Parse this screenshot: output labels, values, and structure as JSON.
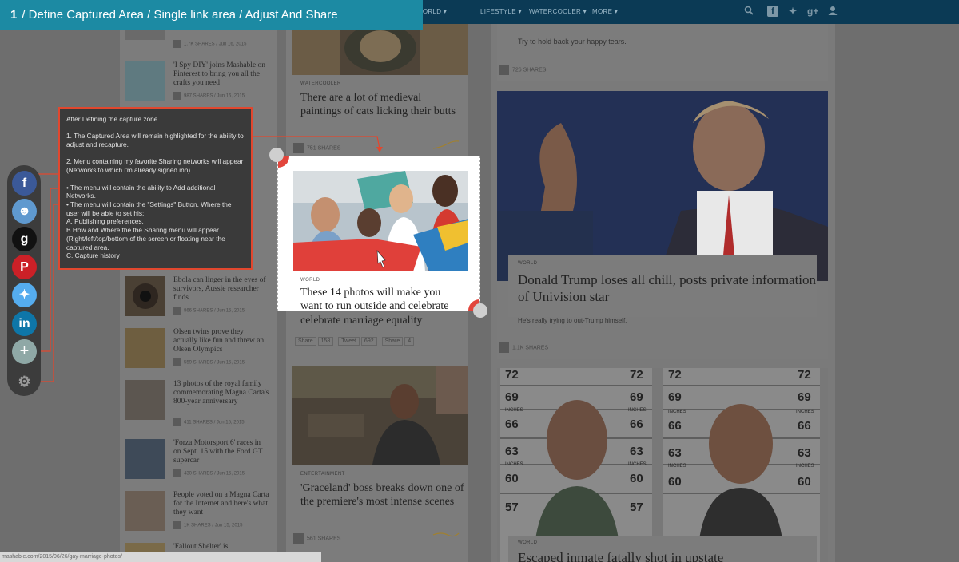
{
  "banner": {
    "step": "1",
    "path": "/ Define Captured Area / Single link area / Adjust And Share"
  },
  "nav": {
    "items": [
      "WORLD",
      "LIFESTYLE",
      "WATERCOOLER",
      "MORE"
    ],
    "icons": [
      "search-icon",
      "facebook-icon",
      "twitter-icon",
      "google-plus-icon",
      "user-icon"
    ],
    "gplus_label": "g+"
  },
  "info": {
    "intro": "After Defining the capture zone.",
    "point1": "1. The Captured Area will remain highlighted for the ability to adjust and recapture.",
    "point2": "2. Menu containing my favorite Sharing networks will appear (Networks to which i'm already signed inn).",
    "bullet1": "• The menu will contain the ability to Add additional Networks.",
    "bullet2": "• The menu will contain the \"Settings\" Button. Where the user will be able to set his:",
    "optA": "A. Publishing preferences.",
    "optB": "B.How and Where the the Sharing menu will appear (Right/left/top/bottom of the screen or floating near the captured area.",
    "optC": "C. Capture history"
  },
  "share_menu": {
    "buttons": [
      {
        "name": "facebook",
        "glyph": "f",
        "color": "#3b5998"
      },
      {
        "name": "reddit",
        "glyph": "☻",
        "color": "#5f99cf"
      },
      {
        "name": "digg",
        "glyph": "g",
        "color": "#111111"
      },
      {
        "name": "pinterest",
        "glyph": "P",
        "color": "#cb2027"
      },
      {
        "name": "twitter",
        "glyph": "✦",
        "color": "#55acee"
      },
      {
        "name": "linkedin",
        "glyph": "in",
        "color": "#0e76a8"
      }
    ],
    "add_glyph": "+",
    "settings_glyph": "⚙"
  },
  "left_column": [
    {
      "title": "",
      "shares": "1.7K SHARES",
      "date": "Jun 16, 2015"
    },
    {
      "title": "'I Spy DIY' joins Mashable on Pinterest to bring you all the crafts you need",
      "shares": "987 SHARES",
      "date": "Jun 16, 2015"
    },
    {
      "title": "Ebola can linger in the eyes of survivors, Aussie researcher finds",
      "shares": "866 SHARES",
      "date": "Jun 15, 2015"
    },
    {
      "title": "Olsen twins prove they actually like fun and threw an Olsen Olympics",
      "shares": "559 SHARES",
      "date": "Jun 15, 2015"
    },
    {
      "title": "13 photos of the royal family commemorating Magna Carta's 800-year anniversary",
      "shares": "411 SHARES",
      "date": "Jun 15, 2015"
    },
    {
      "title": "'Forza Motorsport 6' races in on Sept. 15 with the Ford GT supercar",
      "shares": "430 SHARES",
      "date": "Jun 15, 2015"
    },
    {
      "title": "People voted on a Magna Carta for the Internet and here's what they want",
      "shares": "1K SHARES",
      "date": "Jun 15, 2015"
    },
    {
      "title": "'Fallout Shelter' is",
      "shares": "",
      "date": ""
    }
  ],
  "middle": {
    "cats": {
      "tag": "WATERCOOLER",
      "title": "There are a lot of medieval paintings of cats licking their butts",
      "shares": "751 SHARES"
    },
    "marriage": {
      "title_tail": "celebrate marriage equality",
      "fb_label": "Share",
      "fb_count": "158",
      "tw_label": "Tweet",
      "tw_count": "692",
      "gp_label": "Share",
      "gp_count": "4"
    },
    "graceland": {
      "tag": "ENTERTAINMENT",
      "title": "'Graceland' boss breaks down one of the premiere's most intense scenes",
      "shares": "561 SHARES"
    }
  },
  "capture": {
    "tag": "WORLD",
    "title": "These 14 photos will make you want to run outside and celebrate marriage equality"
  },
  "right": {
    "top_text": "Try to hold back your happy tears.",
    "top_shares": "726 SHARES",
    "trump": {
      "tag": "WORLD",
      "title": "Donald Trump loses all chill, posts private information of Univision star",
      "sub": "He's really trying to out-Trump himself.",
      "shares": "1.1K SHARES"
    },
    "inmate": {
      "tag": "WORLD",
      "title": "Escaped inmate fatally shot in upstate"
    },
    "height_marks": [
      "72",
      "69",
      "66",
      "63",
      "60",
      "57"
    ],
    "height_unit": "INCHES"
  },
  "status_url": "mashable.com/2015/06/26/gay-marriage-photos/"
}
